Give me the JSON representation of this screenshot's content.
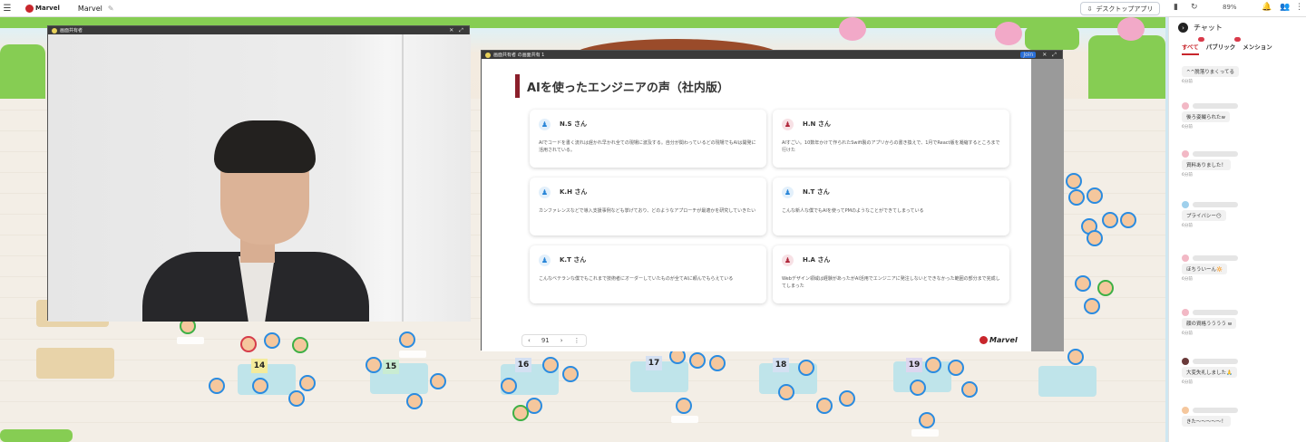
{
  "topbar": {
    "brand": "Marvel",
    "workspace": "Marvel",
    "download_button": "デスクトップアプリ",
    "zoom": "89%"
  },
  "map": {
    "tables": [
      "14",
      "15",
      "16",
      "17",
      "18",
      "19"
    ]
  },
  "video_window": {
    "label": "画面共有者"
  },
  "slide_window": {
    "label": "画面共有者 の画面共有 1",
    "badge": "Join"
  },
  "slide": {
    "title": "AIを使ったエンジニアの声（社内版）",
    "cards": [
      {
        "name": "N.S さん",
        "gender": "male",
        "text": "AIでコードを書く流れは遅かれ早かれ全ての現場に波及する。自分が関わっているどの現場でもAIは開発に活用されている。"
      },
      {
        "name": "H.N さん",
        "gender": "female",
        "text": "AIすごい。10数年かけて作られたSwift製のアプリからの書き換えで、1月でReact版を凝縮するところまで行けた"
      },
      {
        "name": "K.H さん",
        "gender": "male",
        "text": "カンファレンスなどで導入支援事例なども挙げており、どのようなアプローチが最適かを研究していきたい"
      },
      {
        "name": "N.T さん",
        "gender": "male",
        "text": "こんな新人な僕でもAIを使ってPMのようなことができてしまっている"
      },
      {
        "name": "K.T さん",
        "gender": "male",
        "text": "こんなベテランな僕でもこれまで技術者にオーダーしていたものが全てAIに頼んでもらえている"
      },
      {
        "name": "H.A さん",
        "gender": "female",
        "text": "Webデザイン領域は経験があったがAI活用でエンジニアに発注しないとできなかった範囲の部分まで完成してしまった"
      }
    ],
    "page": "91",
    "logo": "Marvel"
  },
  "chat": {
    "title": "チャット",
    "tabs": [
      "すべて",
      "パブリック",
      "メンション"
    ],
    "messages": [
      {
        "text": "^^脱落りまくってる",
        "time": "6分前"
      },
      {
        "text": "後ろ姿撮られたw",
        "time": "6分前"
      },
      {
        "text": "資料ありました！",
        "time": "6分前"
      },
      {
        "text": "プライバシー😶",
        "time": "6分前"
      },
      {
        "text": "ほちういーん🔆",
        "time": "6分前"
      },
      {
        "text": "顔の資格うううう w",
        "time": "6分前"
      },
      {
        "text": "大変失礼しました🙏",
        "time": "6分前"
      },
      {
        "text": "きた〜〜〜〜〜！",
        "time": "6分前"
      }
    ]
  }
}
